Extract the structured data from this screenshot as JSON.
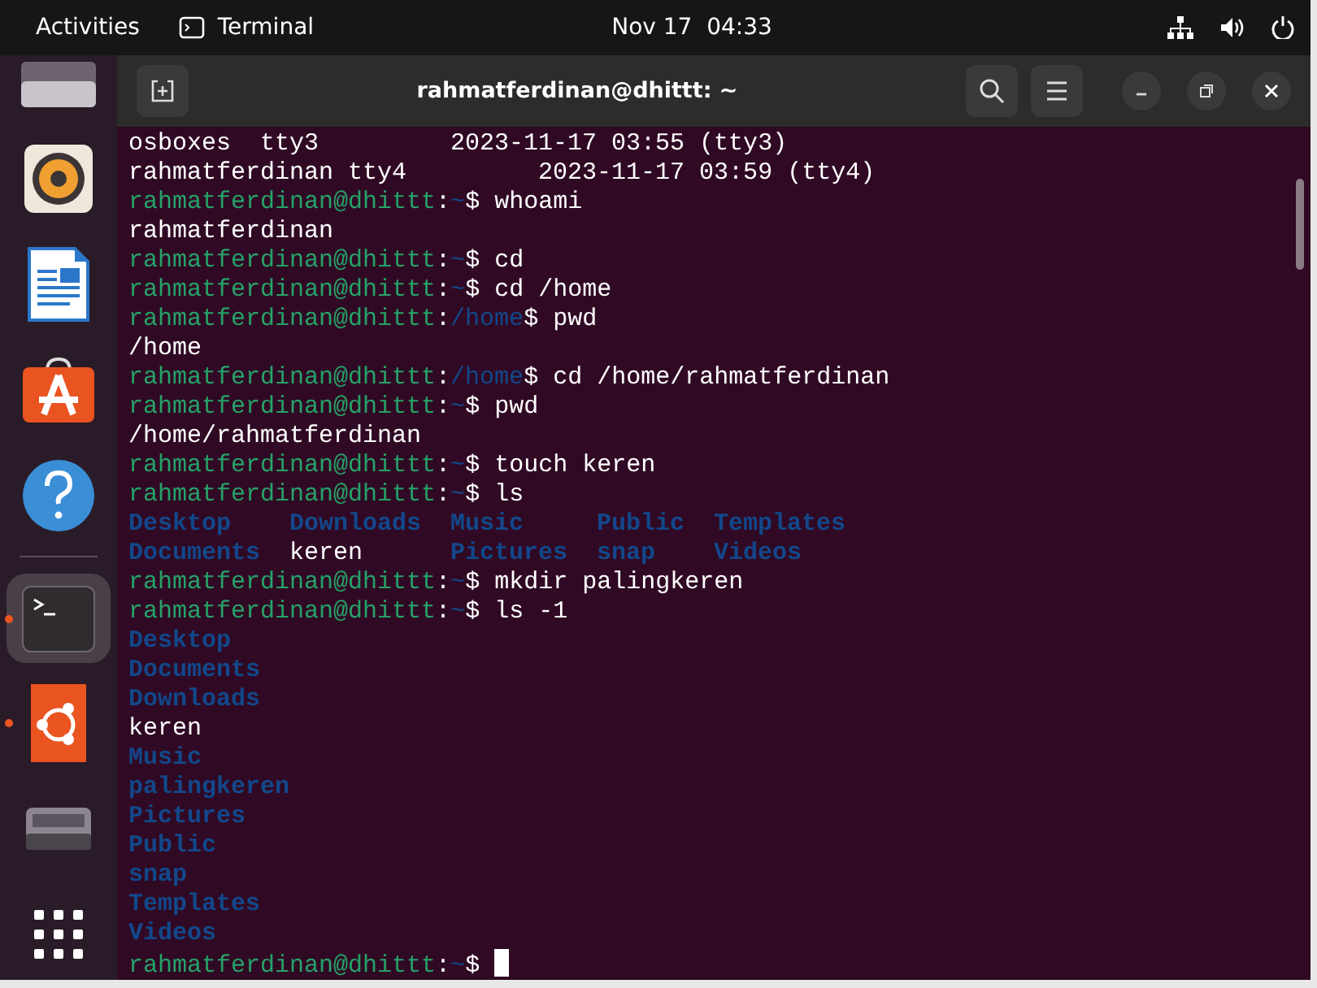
{
  "top_bar": {
    "activities": "Activities",
    "app_menu": "Terminal",
    "clock": "Nov 17  04:33"
  },
  "dock": {
    "items": [
      {
        "kind": "thumbnail",
        "running": false,
        "selected": false
      },
      {
        "kind": "speaker",
        "running": false,
        "selected": false
      },
      {
        "kind": "document",
        "running": false,
        "selected": false
      },
      {
        "kind": "store",
        "running": false,
        "selected": false
      },
      {
        "kind": "help",
        "running": false,
        "selected": false
      },
      {
        "kind": "separator"
      },
      {
        "kind": "terminal",
        "running": true,
        "selected": true
      },
      {
        "kind": "ubuntu",
        "running": true,
        "selected": false
      },
      {
        "kind": "drive",
        "running": false,
        "selected": false
      },
      {
        "kind": "grid",
        "running": false,
        "selected": false
      }
    ]
  },
  "window": {
    "title": "rahmatferdinan@dhittt: ~"
  },
  "terminal": {
    "lines": [
      {
        "kind": "output",
        "text": "osboxes  tty3         2023-11-17 03:55 (tty3)"
      },
      {
        "kind": "output",
        "text": "rahmatferdinan tty4         2023-11-17 03:59 (tty4)"
      },
      {
        "kind": "prompt",
        "user": "rahmatferdinan@dhittt",
        "separator": ":",
        "path": "~",
        "symbol": "$",
        "command": "whoami",
        "cursor": false
      },
      {
        "kind": "output",
        "text": "rahmatferdinan"
      },
      {
        "kind": "prompt",
        "user": "rahmatferdinan@dhittt",
        "separator": ":",
        "path": "~",
        "symbol": "$",
        "command": "cd",
        "cursor": false
      },
      {
        "kind": "prompt",
        "user": "rahmatferdinan@dhittt",
        "separator": ":",
        "path": "~",
        "symbol": "$",
        "command": "cd /home",
        "cursor": false
      },
      {
        "kind": "prompt",
        "user": "rahmatferdinan@dhittt",
        "separator": ":",
        "path": "/home",
        "symbol": "$",
        "command": "pwd",
        "cursor": false
      },
      {
        "kind": "output",
        "text": "/home"
      },
      {
        "kind": "prompt",
        "user": "rahmatferdinan@dhittt",
        "separator": ":",
        "path": "/home",
        "symbol": "$",
        "command": "cd /home/rahmatferdinan",
        "cursor": false
      },
      {
        "kind": "prompt",
        "user": "rahmatferdinan@dhittt",
        "separator": ":",
        "path": "~",
        "symbol": "$",
        "command": "pwd",
        "cursor": false
      },
      {
        "kind": "output",
        "text": "/home/rahmatferdinan"
      },
      {
        "kind": "prompt",
        "user": "rahmatferdinan@dhittt",
        "separator": ":",
        "path": "~",
        "symbol": "$",
        "command": "touch keren",
        "cursor": false
      },
      {
        "kind": "prompt",
        "user": "rahmatferdinan@dhittt",
        "separator": ":",
        "path": "~",
        "symbol": "$",
        "command": "ls",
        "cursor": false
      },
      {
        "kind": "listing",
        "entries": [
          {
            "name": "Desktop",
            "kind": "dir"
          },
          {
            "name": "Downloads",
            "kind": "dir"
          },
          {
            "name": "Music",
            "kind": "dir"
          },
          {
            "name": "Public",
            "kind": "dir"
          },
          {
            "name": "Templates",
            "kind": "dir"
          }
        ]
      },
      {
        "kind": "listing",
        "entries": [
          {
            "name": "Documents",
            "kind": "dir"
          },
          {
            "name": "keren",
            "kind": "file"
          },
          {
            "name": "Pictures",
            "kind": "dir"
          },
          {
            "name": "snap",
            "kind": "dir"
          },
          {
            "name": "Videos",
            "kind": "dir"
          }
        ]
      },
      {
        "kind": "prompt",
        "user": "rahmatferdinan@dhittt",
        "separator": ":",
        "path": "~",
        "symbol": "$",
        "command": "mkdir palingkeren",
        "cursor": false
      },
      {
        "kind": "prompt",
        "user": "rahmatferdinan@dhittt",
        "separator": ":",
        "path": "~",
        "symbol": "$",
        "command": "ls -1",
        "cursor": false
      },
      {
        "kind": "listing",
        "entries": [
          {
            "name": "Desktop",
            "kind": "dir"
          }
        ]
      },
      {
        "kind": "listing",
        "entries": [
          {
            "name": "Documents",
            "kind": "dir"
          }
        ]
      },
      {
        "kind": "listing",
        "entries": [
          {
            "name": "Downloads",
            "kind": "dir"
          }
        ]
      },
      {
        "kind": "listing",
        "entries": [
          {
            "name": "keren",
            "kind": "file"
          }
        ]
      },
      {
        "kind": "listing",
        "entries": [
          {
            "name": "Music",
            "kind": "dir"
          }
        ]
      },
      {
        "kind": "listing",
        "entries": [
          {
            "name": "palingkeren",
            "kind": "dir"
          }
        ]
      },
      {
        "kind": "listing",
        "entries": [
          {
            "name": "Pictures",
            "kind": "dir"
          }
        ]
      },
      {
        "kind": "listing",
        "entries": [
          {
            "name": "Public",
            "kind": "dir"
          }
        ]
      },
      {
        "kind": "listing",
        "entries": [
          {
            "name": "snap",
            "kind": "dir"
          }
        ]
      },
      {
        "kind": "listing",
        "entries": [
          {
            "name": "Templates",
            "kind": "dir"
          }
        ]
      },
      {
        "kind": "listing",
        "entries": [
          {
            "name": "Videos",
            "kind": "dir"
          }
        ]
      },
      {
        "kind": "prompt",
        "user": "rahmatferdinan@dhittt",
        "separator": ":",
        "path": "~",
        "symbol": "$",
        "cursor": true
      }
    ]
  }
}
